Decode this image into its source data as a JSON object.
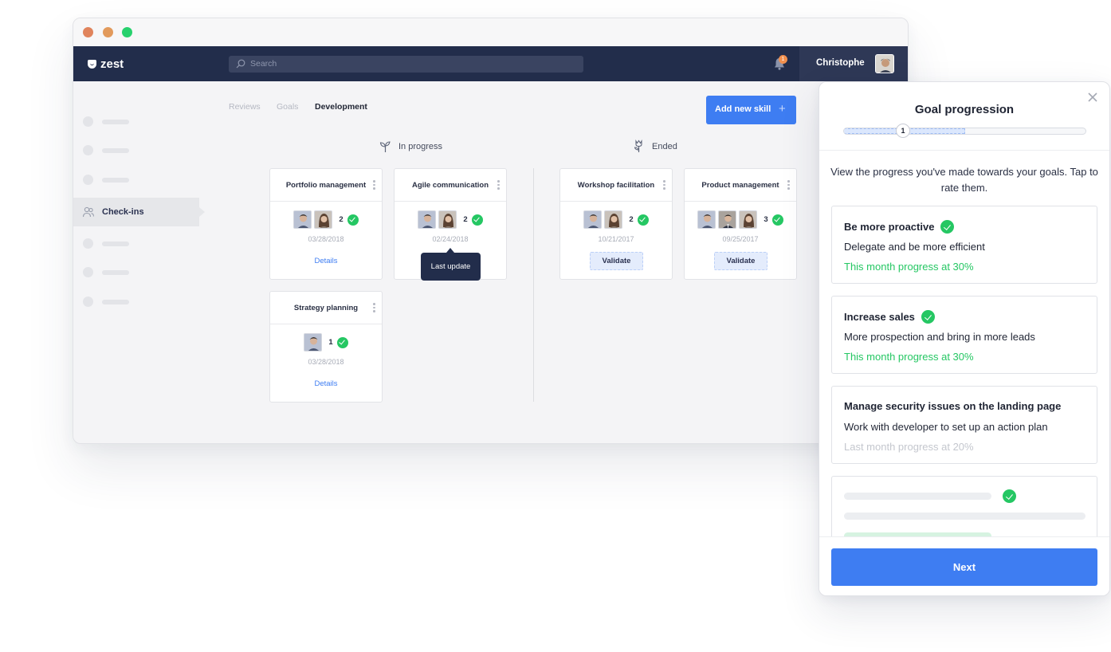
{
  "app": {
    "logo_text": "zest",
    "search_placeholder": "Search",
    "notification_count": "1",
    "user_name": "Christophe"
  },
  "sidebar": {
    "active_label": "Check-ins"
  },
  "tabs": [
    "Reviews",
    "Goals",
    "Development"
  ],
  "active_tab": "Development",
  "add_button": {
    "label": "Add new skill",
    "icon": "+"
  },
  "columns": {
    "in_progress": "In progress",
    "ended": "Ended"
  },
  "cards": [
    {
      "title": "Portfolio management",
      "count": "2",
      "date": "03/28/2018",
      "action": "Details"
    },
    {
      "title": "Agile communication",
      "count": "2",
      "date": "02/24/2018",
      "action": ""
    },
    {
      "title": "Strategy planning",
      "count": "1",
      "date": "03/28/2018",
      "action": "Details"
    },
    {
      "title": "Workshop facilitation",
      "count": "2",
      "date": "10/21/2017",
      "action": "Validate"
    },
    {
      "title": "Product management",
      "count": "3",
      "date": "09/25/2017",
      "action": "Validate"
    }
  ],
  "tooltip": "Last update",
  "panel": {
    "title": "Goal progression",
    "step": "1",
    "progress_fraction": 0.5,
    "intro": "View the progress you've made towards your goals. Tap to rate them.",
    "goals": [
      {
        "title": "Be more proactive",
        "desc": "Delegate and be more efficient",
        "progress": "This month progress at 30%",
        "checked": true
      },
      {
        "title": "Increase sales",
        "desc": "More prospection and bring in more leads",
        "progress": "This month progress at 30%",
        "checked": true
      },
      {
        "title": "Manage security issues on the landing page",
        "desc": "Work with developer to set up an action plan",
        "progress": "Last month progress at 20%",
        "checked": false
      }
    ],
    "next_label": "Next"
  },
  "colors": {
    "navbar": "#222d4b",
    "accent": "#3e7df2",
    "success": "#25c763"
  }
}
